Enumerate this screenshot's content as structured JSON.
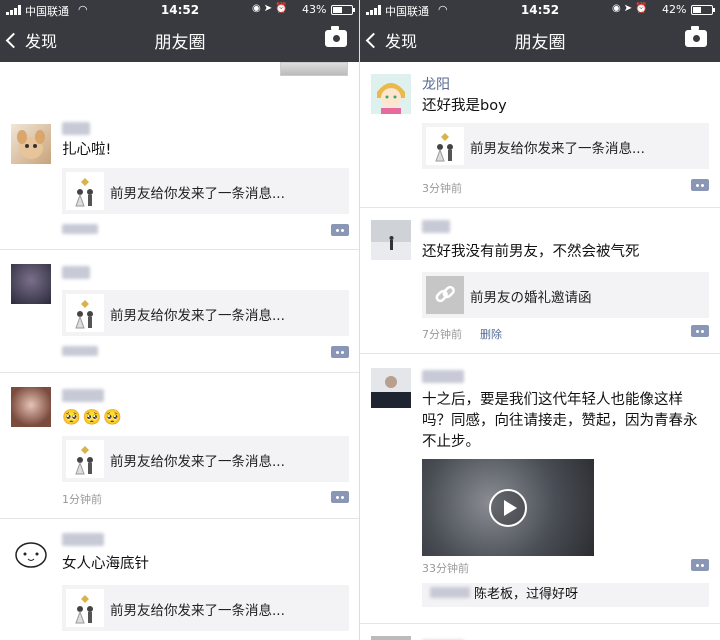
{
  "colors": {
    "nav_bar": "#393a3f",
    "name_link": "#576b95",
    "card_bg": "#f3f3f5"
  },
  "screens": [
    {
      "status": {
        "carrier": "中国联通",
        "time": "14:52",
        "battery": "43%",
        "battery_level": 0.43
      },
      "nav": {
        "back_label": "发现",
        "title": "朋友圈",
        "camera_icon": "camera-icon"
      },
      "posts": [
        {
          "name": "",
          "text": "扎心啦!",
          "link_title": "前男友给你发来了一条消息...",
          "time": ""
        },
        {
          "name": "",
          "text": "",
          "link_title": "前男友给你发来了一条消息...",
          "time": ""
        },
        {
          "name": "",
          "text": "🥺🥺🥺",
          "link_title": "前男友给你发来了一条消息...",
          "time": "1分钟前"
        },
        {
          "name": "",
          "text": "女人心海底针",
          "link_title": "前男友给你发来了一条消息...",
          "time": ""
        }
      ]
    },
    {
      "status": {
        "carrier": "中国联通",
        "time": "14:52",
        "battery": "42%",
        "battery_level": 0.42
      },
      "nav": {
        "back_label": "发现",
        "title": "朋友圈",
        "camera_icon": "camera-icon"
      },
      "posts": [
        {
          "name": "龙阳",
          "text": "还好我是boy",
          "link_title": "前男友给你发来了一条消息...",
          "time": "3分钟前"
        },
        {
          "name": "",
          "text": "还好我没有前男友，不然会被气死",
          "link_title": "前男友の婚礼邀请函",
          "time": "7分钟前",
          "delete": "删除"
        },
        {
          "name": "",
          "text_lines": [
            "十之后，要是我们这代年轻人也能像这样",
            "吗？同感，向往请接走，赞起，因为青春永",
            "不止步。"
          ],
          "time": "33分钟前",
          "comment": "陈老板，过得好呀"
        }
      ]
    }
  ]
}
